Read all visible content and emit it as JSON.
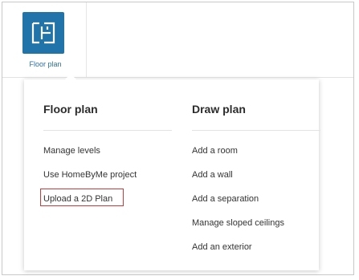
{
  "toolbar": {
    "floor_plan_button": {
      "label": "Floor plan",
      "icon": "floor-plan-icon",
      "icon_bg_color": "#2174a9"
    }
  },
  "menu": {
    "columns": [
      {
        "title": "Floor plan",
        "items": [
          "Manage levels",
          "Use HomeByMe project",
          "Upload a 2D Plan"
        ]
      },
      {
        "title": "Draw plan",
        "items": [
          "Add a room",
          "Add a wall",
          "Add a separation",
          "Manage sloped ceilings",
          "Add an exterior"
        ]
      }
    ],
    "highlighted_item": "Upload a 2D Plan",
    "highlight_color": "#d23a3a"
  }
}
